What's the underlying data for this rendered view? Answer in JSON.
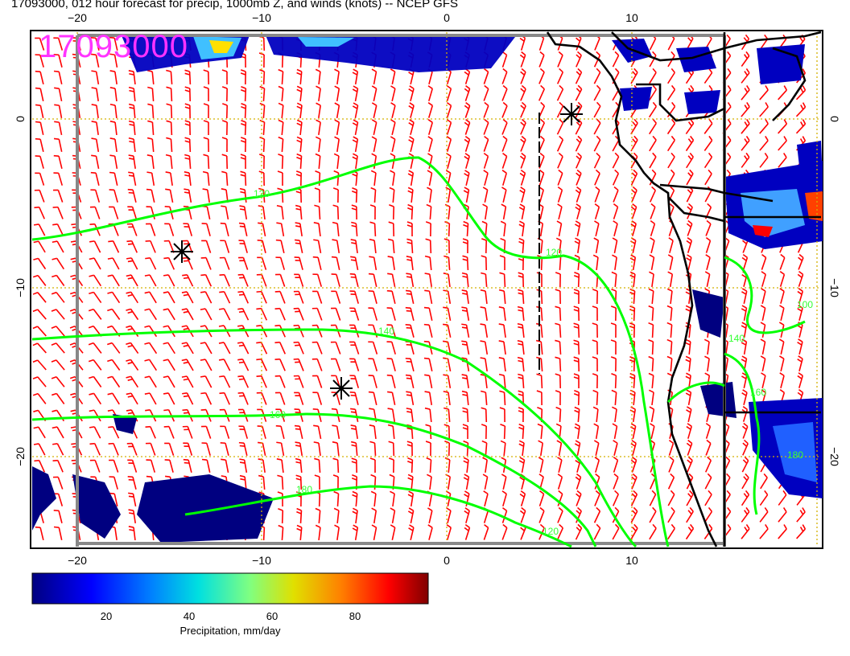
{
  "title": "17093000, 012 hour forecast for precip, 1000mb Z, and winds (knots) -- NCEP GFS",
  "stamp": "17093000",
  "axes": {
    "x_ticks_top": [
      "−20",
      "−10",
      "0",
      "10"
    ],
    "x_ticks_bottom": [
      "−20",
      "−10",
      "0",
      "10"
    ],
    "y_ticks_left": [
      "0",
      "−10",
      "−20"
    ],
    "y_ticks_right": [
      "0",
      "−10",
      "−20"
    ]
  },
  "contour_labels": [
    "120",
    "120",
    "140",
    "160",
    "180",
    "100",
    "140",
    "160",
    "180",
    "120"
  ],
  "colorbar": {
    "ticks": [
      "20",
      "40",
      "60",
      "80"
    ],
    "label": "Precipitation, mm/day",
    "colors": [
      "#000080",
      "#0000ff",
      "#0080ff",
      "#00e0e0",
      "#80ff80",
      "#e0e000",
      "#ff8000",
      "#ff0000",
      "#800000"
    ]
  },
  "colors": {
    "wind_barbs": "#ff0000",
    "contours": "#00ff00",
    "grid": "#d4b000",
    "stamp": "#ff33ff"
  }
}
